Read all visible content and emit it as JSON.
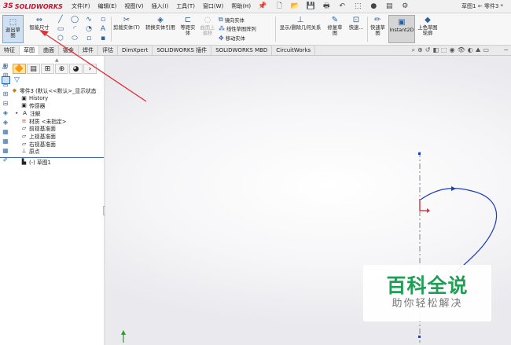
{
  "app": {
    "logo_text": "SOLIDWORKS",
    "logo_mark": "3S",
    "doc_title": "草图1 ← 零件3 *"
  },
  "menu": [
    "文件(F)",
    "编辑(E)",
    "视图(V)",
    "插入(I)",
    "工具(T)",
    "窗口(W)",
    "帮助(H)"
  ],
  "ribbon": {
    "exit_sketch": "退出草图",
    "smart_dim": "智能尺寸",
    "trim": "剪裁实体(T)",
    "convert": "转换实体引用",
    "offset": "等距实体",
    "surface_offset": "曲面上偏移",
    "mirror": "镜向实体",
    "linear_pattern": "线性草图阵列",
    "move": "移动实体",
    "display_relations": "显示/删除几何关系",
    "repair": "修复草图",
    "quick_snaps": "快速...",
    "rapid_sketch": "快速草图",
    "instant2d": "Instant2D",
    "shaded_contours": "上色草图轮廓"
  },
  "tabs": [
    "特征",
    "草图",
    "曲面",
    "钣金",
    "焊件",
    "评估",
    "DimXpert",
    "SOLIDWORKS 插件",
    "SOLIDWORKS MBD",
    "CircuitWorks"
  ],
  "active_tab": 1,
  "tree": [
    {
      "icon": "part-icon",
      "label": "零件3 (默认<<默认>_显示状态"
    },
    {
      "icon": "history-icon",
      "label": "History"
    },
    {
      "icon": "sensor-icon",
      "label": "传感器"
    },
    {
      "icon": "annotation-icon",
      "label": "注解"
    },
    {
      "icon": "material-icon",
      "label": "材质 <未指定>"
    },
    {
      "icon": "plane-icon",
      "label": "前视基准面"
    },
    {
      "icon": "plane-icon",
      "label": "上视基准面"
    },
    {
      "icon": "plane-icon",
      "label": "右视基准面"
    },
    {
      "icon": "origin-icon",
      "label": "原点"
    },
    {
      "icon": "sketch-icon",
      "label": "(-) 草图1"
    }
  ],
  "watermark": {
    "main": "百科全说",
    "sub": "助你轻松解决"
  },
  "colors": {
    "arrow": "#e0303a",
    "sketch_curve": "#1d3fbf",
    "watermark_green": "#1f9f55"
  }
}
